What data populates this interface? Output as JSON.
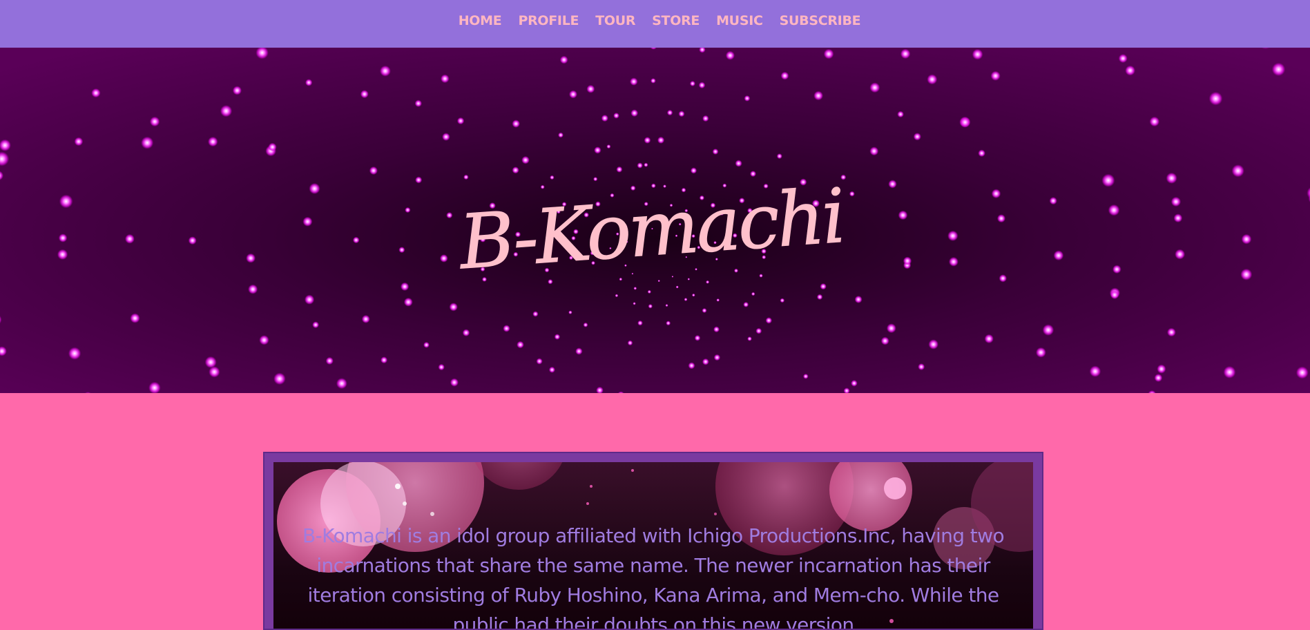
{
  "nav": {
    "items": [
      {
        "label": "HOME"
      },
      {
        "label": "PROFILE"
      },
      {
        "label": "TOUR"
      },
      {
        "label": "STORE"
      },
      {
        "label": "MUSIC"
      },
      {
        "label": "SUBSCRIBE"
      }
    ]
  },
  "hero": {
    "logo_text": "B-Komachi"
  },
  "about": {
    "text": "B-Komachi is an idol group affiliated with Ichigo Productions.Inc, having two incarnations that share the same name. The newer incarnation has their iteration consisting of Ruby Hoshino, Kana Arima, and Mem-cho. While the public had their doubts on this new version"
  },
  "colors": {
    "nav_bg": "#9370db",
    "nav_text": "#ffb6c1",
    "page_bg": "#ff69aa",
    "about_text": "#a07ce0",
    "logo": "#ffc0cb"
  }
}
